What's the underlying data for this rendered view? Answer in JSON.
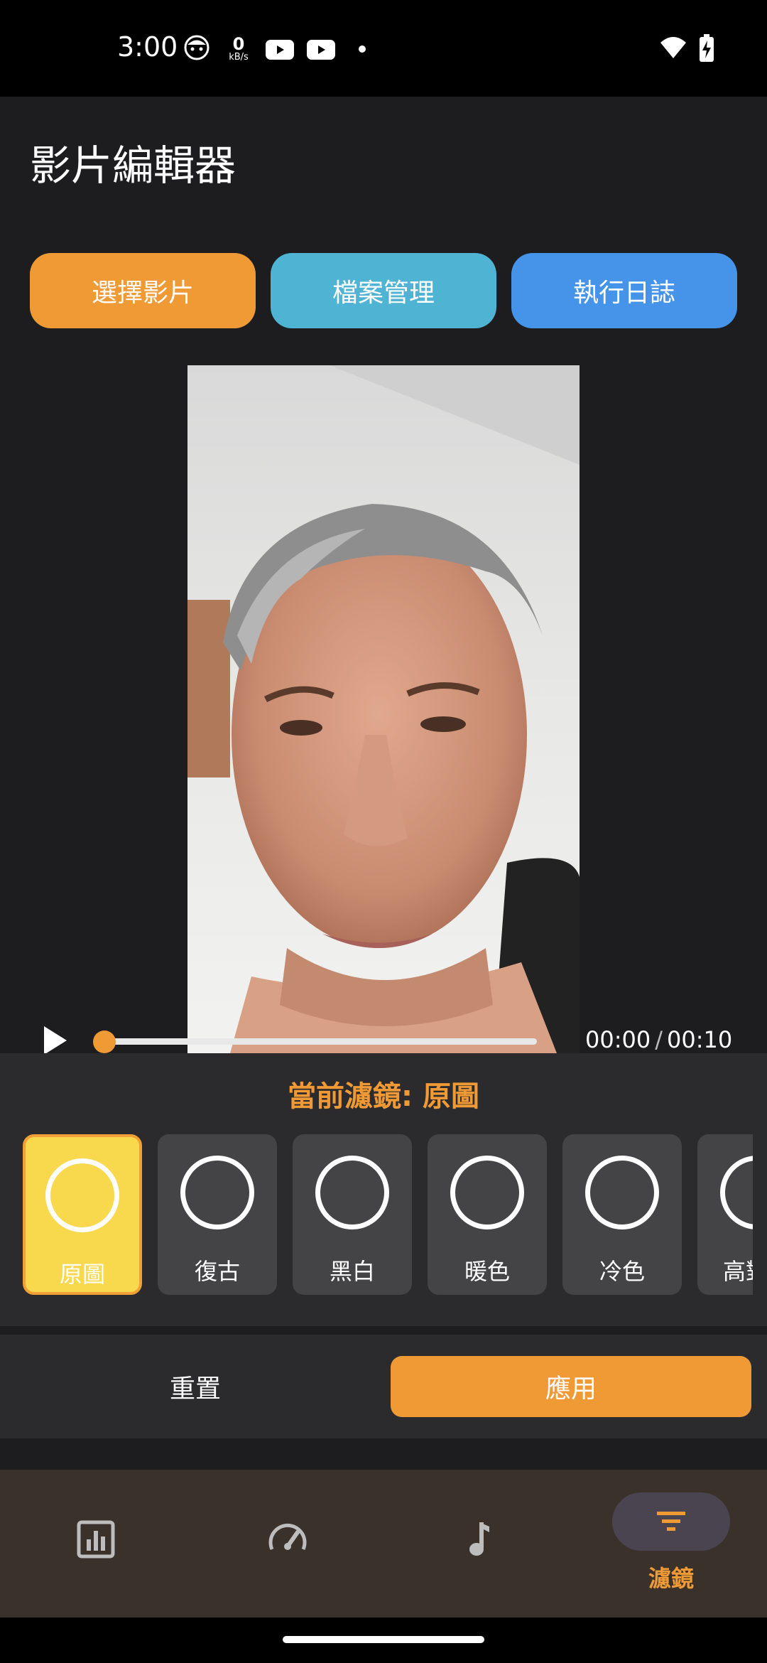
{
  "status_bar": {
    "time": "3:00",
    "net_speed_value": "0",
    "net_speed_unit": "kB/s",
    "icons": [
      "face-icon",
      "kbs-indicator",
      "youtube-icon",
      "youtube-icon",
      "dot-icon",
      "wifi-icon",
      "battery-charging-icon"
    ]
  },
  "header": {
    "title": "影片編輯器"
  },
  "toolbar": {
    "select_video": "選擇影片",
    "file_manager": "檔案管理",
    "run_log": "執行日誌"
  },
  "player": {
    "current_time": "00:00",
    "separator": "/",
    "duration": "00:10",
    "progress": 0
  },
  "filter_panel": {
    "current_label": "當前濾鏡: ",
    "current_value": "原圖",
    "filters": [
      {
        "label": "原圖",
        "selected": true
      },
      {
        "label": "復古",
        "selected": false
      },
      {
        "label": "黑白",
        "selected": false
      },
      {
        "label": "暖色",
        "selected": false
      },
      {
        "label": "冷色",
        "selected": false
      },
      {
        "label": "高對比",
        "selected": false
      }
    ]
  },
  "actions": {
    "reset": "重置",
    "apply": "應用"
  },
  "bottom_nav": {
    "items": [
      {
        "icon": "bar-chart-icon",
        "label": ""
      },
      {
        "icon": "speedometer-icon",
        "label": ""
      },
      {
        "icon": "music-note-icon",
        "label": ""
      },
      {
        "icon": "filter-icon",
        "label": "濾鏡",
        "active": true
      }
    ]
  },
  "colors": {
    "accent_orange": "#ef9a35",
    "button_teal": "#4fb3d3",
    "button_blue": "#4694e9",
    "selected_filter_yellow": "#f8d84c",
    "background": "#1d1d1f"
  }
}
